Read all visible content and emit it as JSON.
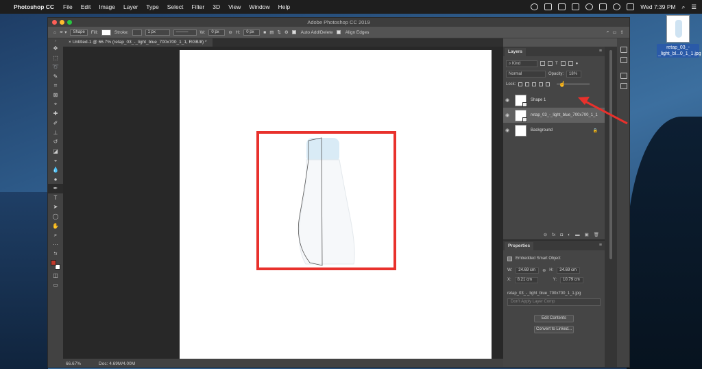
{
  "menubar": {
    "app_name": "Photoshop CC",
    "items": [
      "File",
      "Edit",
      "Image",
      "Layer",
      "Type",
      "Select",
      "Filter",
      "3D",
      "View",
      "Window",
      "Help"
    ],
    "clock": "Wed 7:39 PM"
  },
  "desktop": {
    "file_label": "retap_03_-_light_bl...0_1_1.jpg"
  },
  "window": {
    "title": "Adobe Photoshop CC 2019",
    "doc_tab": "Untitled-1 @ 66.7% (retap_03_-_light_blue_700x700_1_1, RGB/8) *"
  },
  "options_bar": {
    "mode": "Shape",
    "fill_label": "Fill:",
    "stroke_label": "Stroke:",
    "stroke_width": "1 px",
    "w_label": "W:",
    "w_value": "0 px",
    "h_label": "H:",
    "h_value": "0 px",
    "auto_add_delete": "Auto Add/Delete",
    "align_edges": "Align Edges"
  },
  "status": {
    "zoom": "66.67%",
    "doc": "Doc: 4.69M/4.00M"
  },
  "layers_panel": {
    "tab": "Layers",
    "filter": "Kind",
    "blend_mode": "Normal",
    "opacity_label": "Opacity:",
    "opacity_value": "18%",
    "lock_label": "Lock:",
    "layers": [
      {
        "name": "Shape 1"
      },
      {
        "name": "retap_03_-_light_blue_700x700_1_1"
      },
      {
        "name": "Background"
      }
    ]
  },
  "properties_panel": {
    "tab": "Properties",
    "type": "Embedded Smart Object",
    "w_label": "W:",
    "w_value": "24.69 cm",
    "h_label": "H:",
    "h_value": "24.69 cm",
    "x_label": "X:",
    "x_value": "8.21 cm",
    "y_label": "Y:",
    "y_value": "10.79 cm",
    "filename": "retap_03_-_light_blue_700x700_1_1.jpg",
    "layer_comp": "Don't Apply Layer Comp",
    "edit_contents": "Edit Contents",
    "convert_linked": "Convert to Linked..."
  },
  "colors": {
    "highlight": "#e8312c",
    "foreground_swatch": "#c0392b",
    "bottle_cap": "#d9ebf6"
  }
}
